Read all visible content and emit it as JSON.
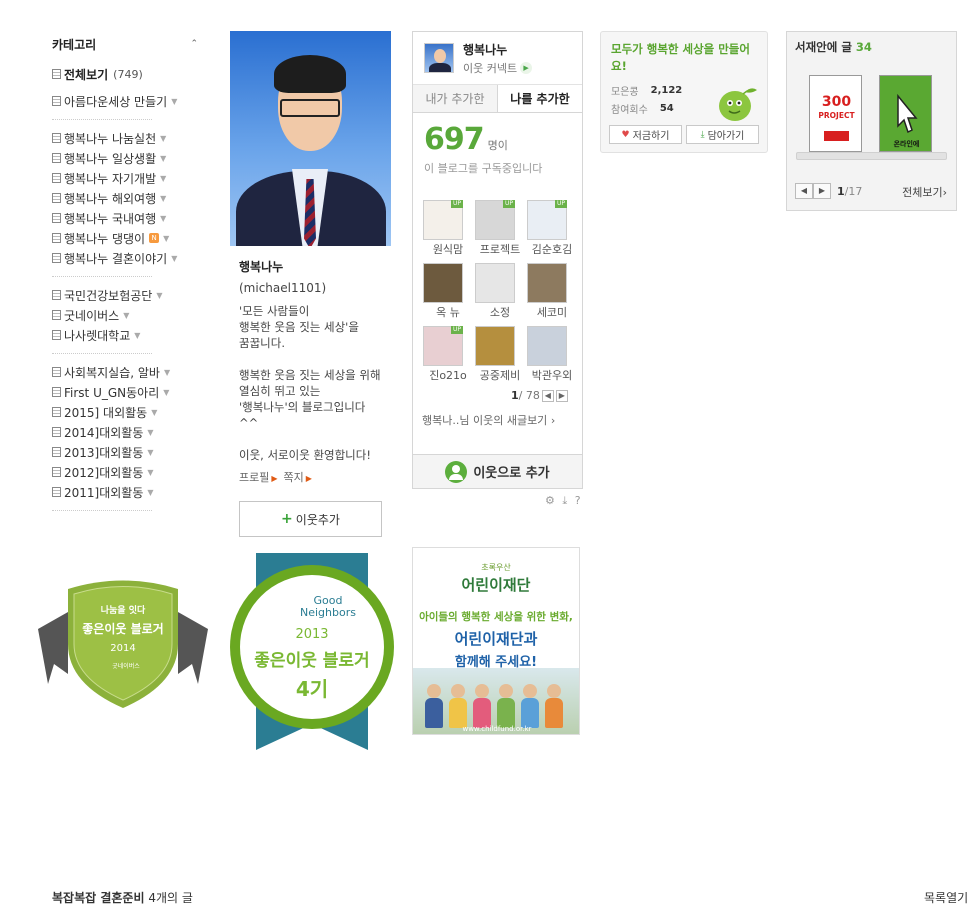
{
  "category": {
    "title": "카테고리",
    "collapse_icon": "⌃",
    "all": {
      "label": "전체보기",
      "count": "(749)"
    },
    "group1": [
      "아름다운세상 만들기"
    ],
    "group2": [
      {
        "label": "행복나누 나눔실천"
      },
      {
        "label": "행복나누 일상생활"
      },
      {
        "label": "행복나누 자기개발"
      },
      {
        "label": "행복나누 해외여행"
      },
      {
        "label": "행복나누 국내여행"
      },
      {
        "label": "행복나누 댕댕이",
        "badge": "N"
      },
      {
        "label": "행복나누 결혼이야기"
      }
    ],
    "group3": [
      "국민건강보험공단",
      "굿네이버스",
      "나사렛대학교"
    ],
    "group4": [
      "사회복지실습, 알바",
      "First U_GN동아리",
      "2015] 대외활동",
      "2014]대외활동",
      "2013]대외활동",
      "2012]대외활동",
      "2011]대외활동"
    ]
  },
  "profile": {
    "name": "행복나누",
    "id": "(michael1101)",
    "description": "'모든 사람들이\n행복한 웃음 짓는 세상'을\n꿈꿉니다.\n\n행복한 웃음 짓는 세상을 위해 열심히 뛰고 있는\n'행복나누'의 블로그입니다^^\n\n이웃, 서로이웃 환영합니다!",
    "link_profile": "프로필",
    "link_note": "쪽지",
    "add_button": "이웃추가"
  },
  "neighbor": {
    "blog_name": "행복나누",
    "connect_label": "이웃 커넥트",
    "tab_mine": "내가 추가한",
    "tab_added_me": "나를 추가한",
    "count": "697",
    "count_unit": "명이",
    "subscribe_text": "이 블로그를 구독중입니다",
    "people": [
      {
        "name": "원식맘",
        "up": "UP",
        "color": "#f4f0ea"
      },
      {
        "name": "프로젝트",
        "up": "UP",
        "color": "#d7d7d7"
      },
      {
        "name": "김순호김",
        "up": "UP",
        "color": "#e9eef4"
      },
      {
        "name": "옥 뉴",
        "up": "",
        "color": "#6d5a3e"
      },
      {
        "name": "소정",
        "up": "",
        "color": "#e6e6e6"
      },
      {
        "name": "세코미",
        "up": "",
        "color": "#8d7a5f"
      },
      {
        "name": "진o21o",
        "up": "UP",
        "color": "#e8cfd2"
      },
      {
        "name": "공중제비",
        "up": "",
        "color": "#b58f3e"
      },
      {
        "name": "박관우외",
        "up": "",
        "color": "#c9d1dc"
      }
    ],
    "page_current": "1",
    "page_total": "/ 78",
    "new_posts_text": "행복나..님 이웃의 새글보기",
    "add_label": "이웃으로 추가",
    "tools": "⚙ ⤓ ?"
  },
  "campaign": {
    "title": "모두가 행복한 세상을 만들어요!",
    "fund_label": "모은콩",
    "fund_value": "2,122",
    "join_label": "참여회수",
    "join_value": "54",
    "btn_donate": "저금하기",
    "btn_save": "담아가기"
  },
  "shelf": {
    "title": "서재안에 글",
    "count": "34",
    "book1_title": "300 PROJECT",
    "book2_title": "온라인에 미쳐라",
    "page_current": "1",
    "page_total": "/17",
    "more": "전체보기"
  },
  "badge2014": {
    "line1": "나눔을 잇다",
    "line2": "좋은이웃 블로거",
    "year": "2014",
    "brand": "굿네이버스"
  },
  "badge2013": {
    "brand1": "Good",
    "brand2": "Neighbors",
    "year": "2013",
    "line1": "좋은이웃 블로거",
    "line2": "4기"
  },
  "childfund": {
    "small": "초록우산",
    "logo": "어린이재단",
    "line1": "아이들의 행복한 세상을 위한 변화,",
    "line2": "어린이재단과",
    "line3": "함께해 주세요!",
    "url": "www.childfund.or.kr"
  },
  "footer": {
    "category": "복잡복잡 결혼준비",
    "count_text": "4개의 글",
    "list_toggle": "목록열기"
  },
  "colors": {
    "accent_green": "#59a83a",
    "link_orange": "#e05a14"
  }
}
